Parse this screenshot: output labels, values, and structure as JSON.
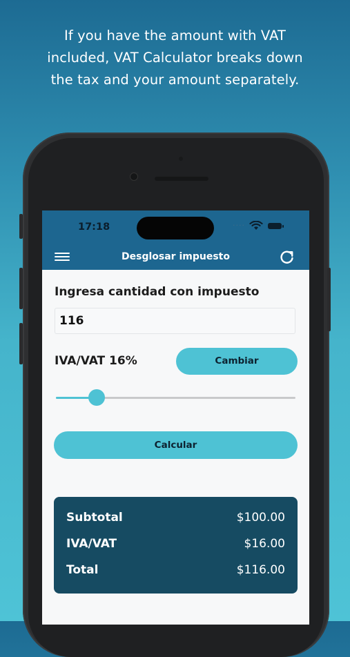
{
  "promo": {
    "line1": "If you have the amount with VAT",
    "line2": "included, VAT Calculator breaks down",
    "line3": "the tax and your amount separately."
  },
  "status_bar": {
    "time": "17:18"
  },
  "app_bar": {
    "title": "Desglosar impuesto",
    "menu_icon": "hamburger-menu-icon",
    "refresh_icon": "refresh-icon"
  },
  "form": {
    "amount_label": "Ingresa cantidad con impuesto",
    "amount_value": "116",
    "vat_label": "IVA/VAT 16%",
    "change_button": "Cambiar",
    "vat_slider_fraction": 0.17,
    "calculate_button": "Calcular"
  },
  "results": {
    "rows": [
      {
        "label": "Subtotal",
        "value": "$100.00"
      },
      {
        "label": "IVA/VAT",
        "value": "$16.00"
      },
      {
        "label": "Total",
        "value": "$116.00"
      }
    ]
  },
  "colors": {
    "accent": "#4ec2d4",
    "appbar": "#1d6690",
    "results_panel": "#164b62"
  }
}
